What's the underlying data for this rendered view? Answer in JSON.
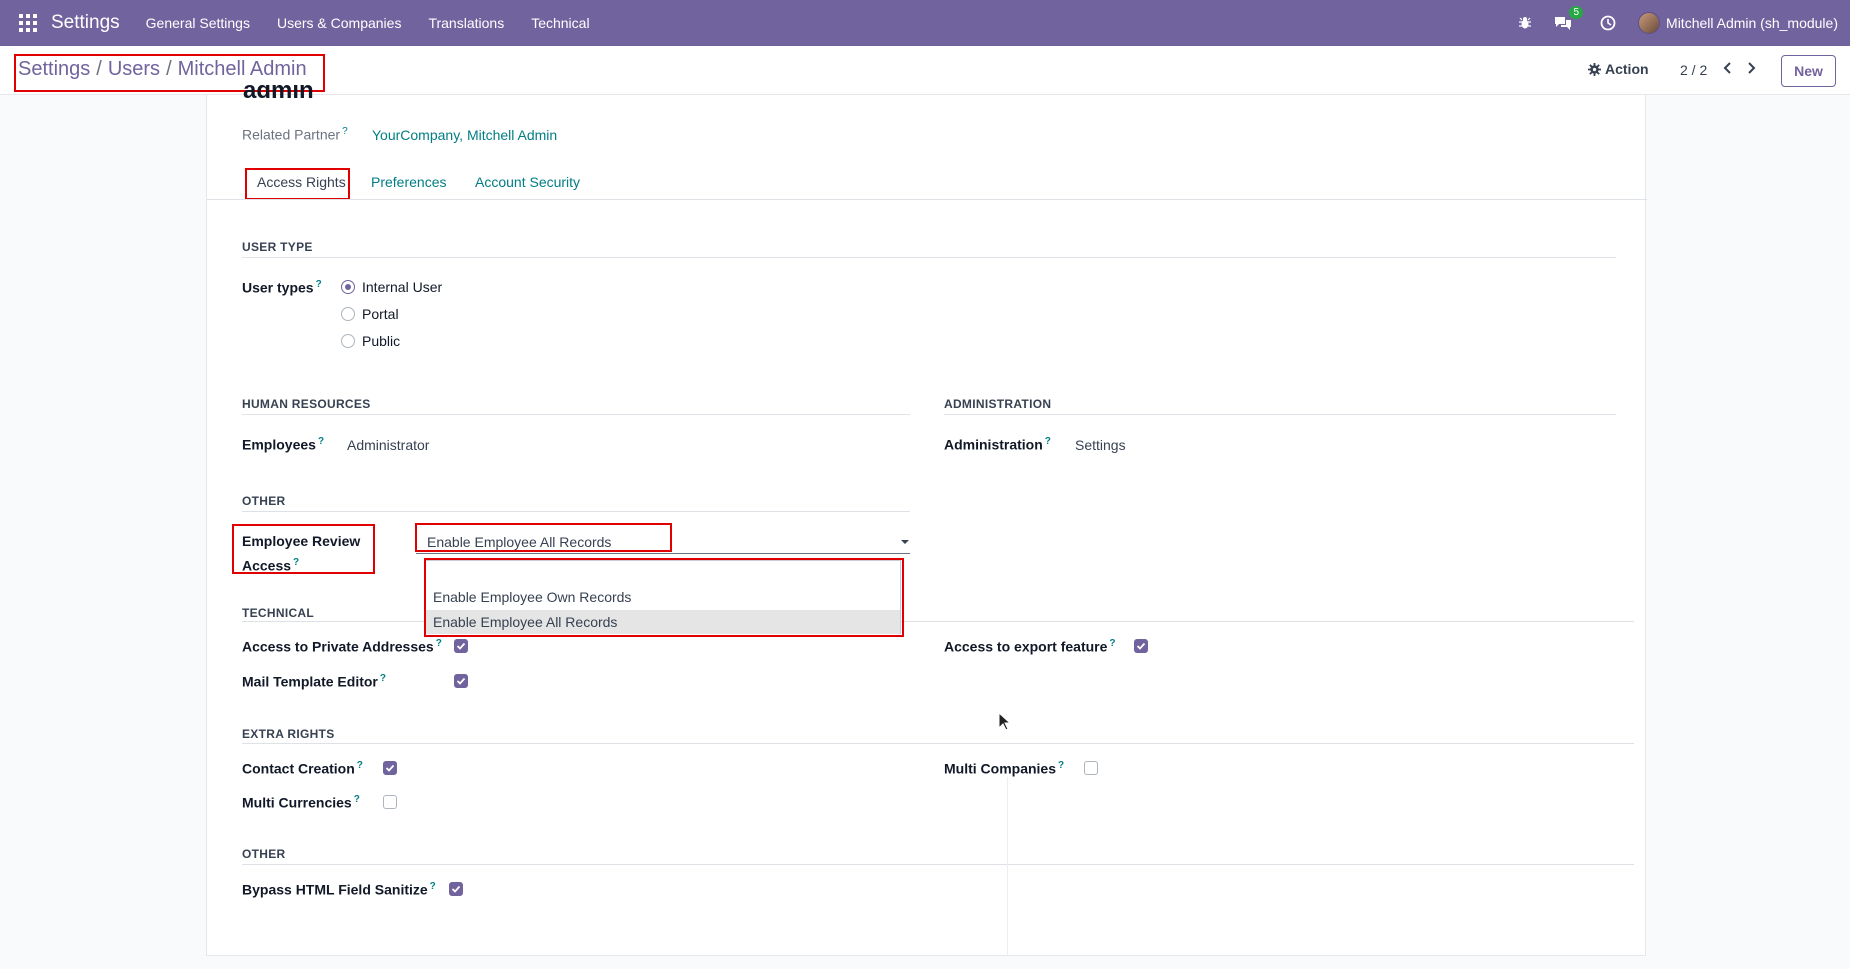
{
  "navbar": {
    "app_name": "Settings",
    "menu": [
      "General Settings",
      "Users & Companies",
      "Translations",
      "Technical"
    ],
    "chat_badge": "5",
    "user": "Mitchell Admin (sh_module)",
    "icons": [
      "apps-grid-icon",
      "bug-icon",
      "chat-icon",
      "clock-icon"
    ]
  },
  "control_panel": {
    "breadcrumb": [
      "Settings",
      "Users",
      "Mitchell Admin"
    ],
    "action_label": "Action",
    "pager": "2 / 2",
    "new_label": "New"
  },
  "form": {
    "record_name_fragment": "admin",
    "related_partner_label": "Related Partner",
    "related_partner_value": "YourCompany, Mitchell Admin",
    "tabs": [
      "Access Rights",
      "Preferences",
      "Account Security"
    ],
    "active_tab": "Access Rights",
    "user_type": {
      "section": "USER TYPE",
      "label": "User types",
      "options": [
        "Internal User",
        "Portal",
        "Public"
      ],
      "selected": "Internal User"
    },
    "human_resources": {
      "section": "HUMAN RESOURCES",
      "label": "Employees",
      "value": "Administrator"
    },
    "administration": {
      "section": "ADMINISTRATION",
      "label": "Administration",
      "value": "Settings"
    },
    "other": {
      "section": "OTHER",
      "label_line1": "Employee Review",
      "label_line2": "Access",
      "value": "Enable Employee All Records",
      "dropdown_options": [
        "",
        "Enable Employee Own Records",
        "Enable Employee All Records"
      ],
      "dropdown_selected": "Enable Employee All Records"
    },
    "technical": {
      "section": "TECHNICAL",
      "fields": [
        {
          "label": "Access to Private Addresses",
          "checked": true
        },
        {
          "label": "Mail Template Editor",
          "checked": true
        },
        {
          "label": "Access to export feature",
          "checked": true
        }
      ]
    },
    "extra_rights": {
      "section": "EXTRA RIGHTS",
      "fields": [
        {
          "label": "Contact Creation",
          "checked": true
        },
        {
          "label": "Multi Currencies",
          "checked": false
        },
        {
          "label": "Multi Companies",
          "checked": false
        }
      ]
    },
    "other2": {
      "section": "OTHER",
      "fields": [
        {
          "label": "Bypass HTML Field Sanitize",
          "checked": true
        }
      ]
    }
  },
  "colors": {
    "navbar_bg": "#71639e",
    "link": "#017e84",
    "highlight": "#e00000"
  }
}
